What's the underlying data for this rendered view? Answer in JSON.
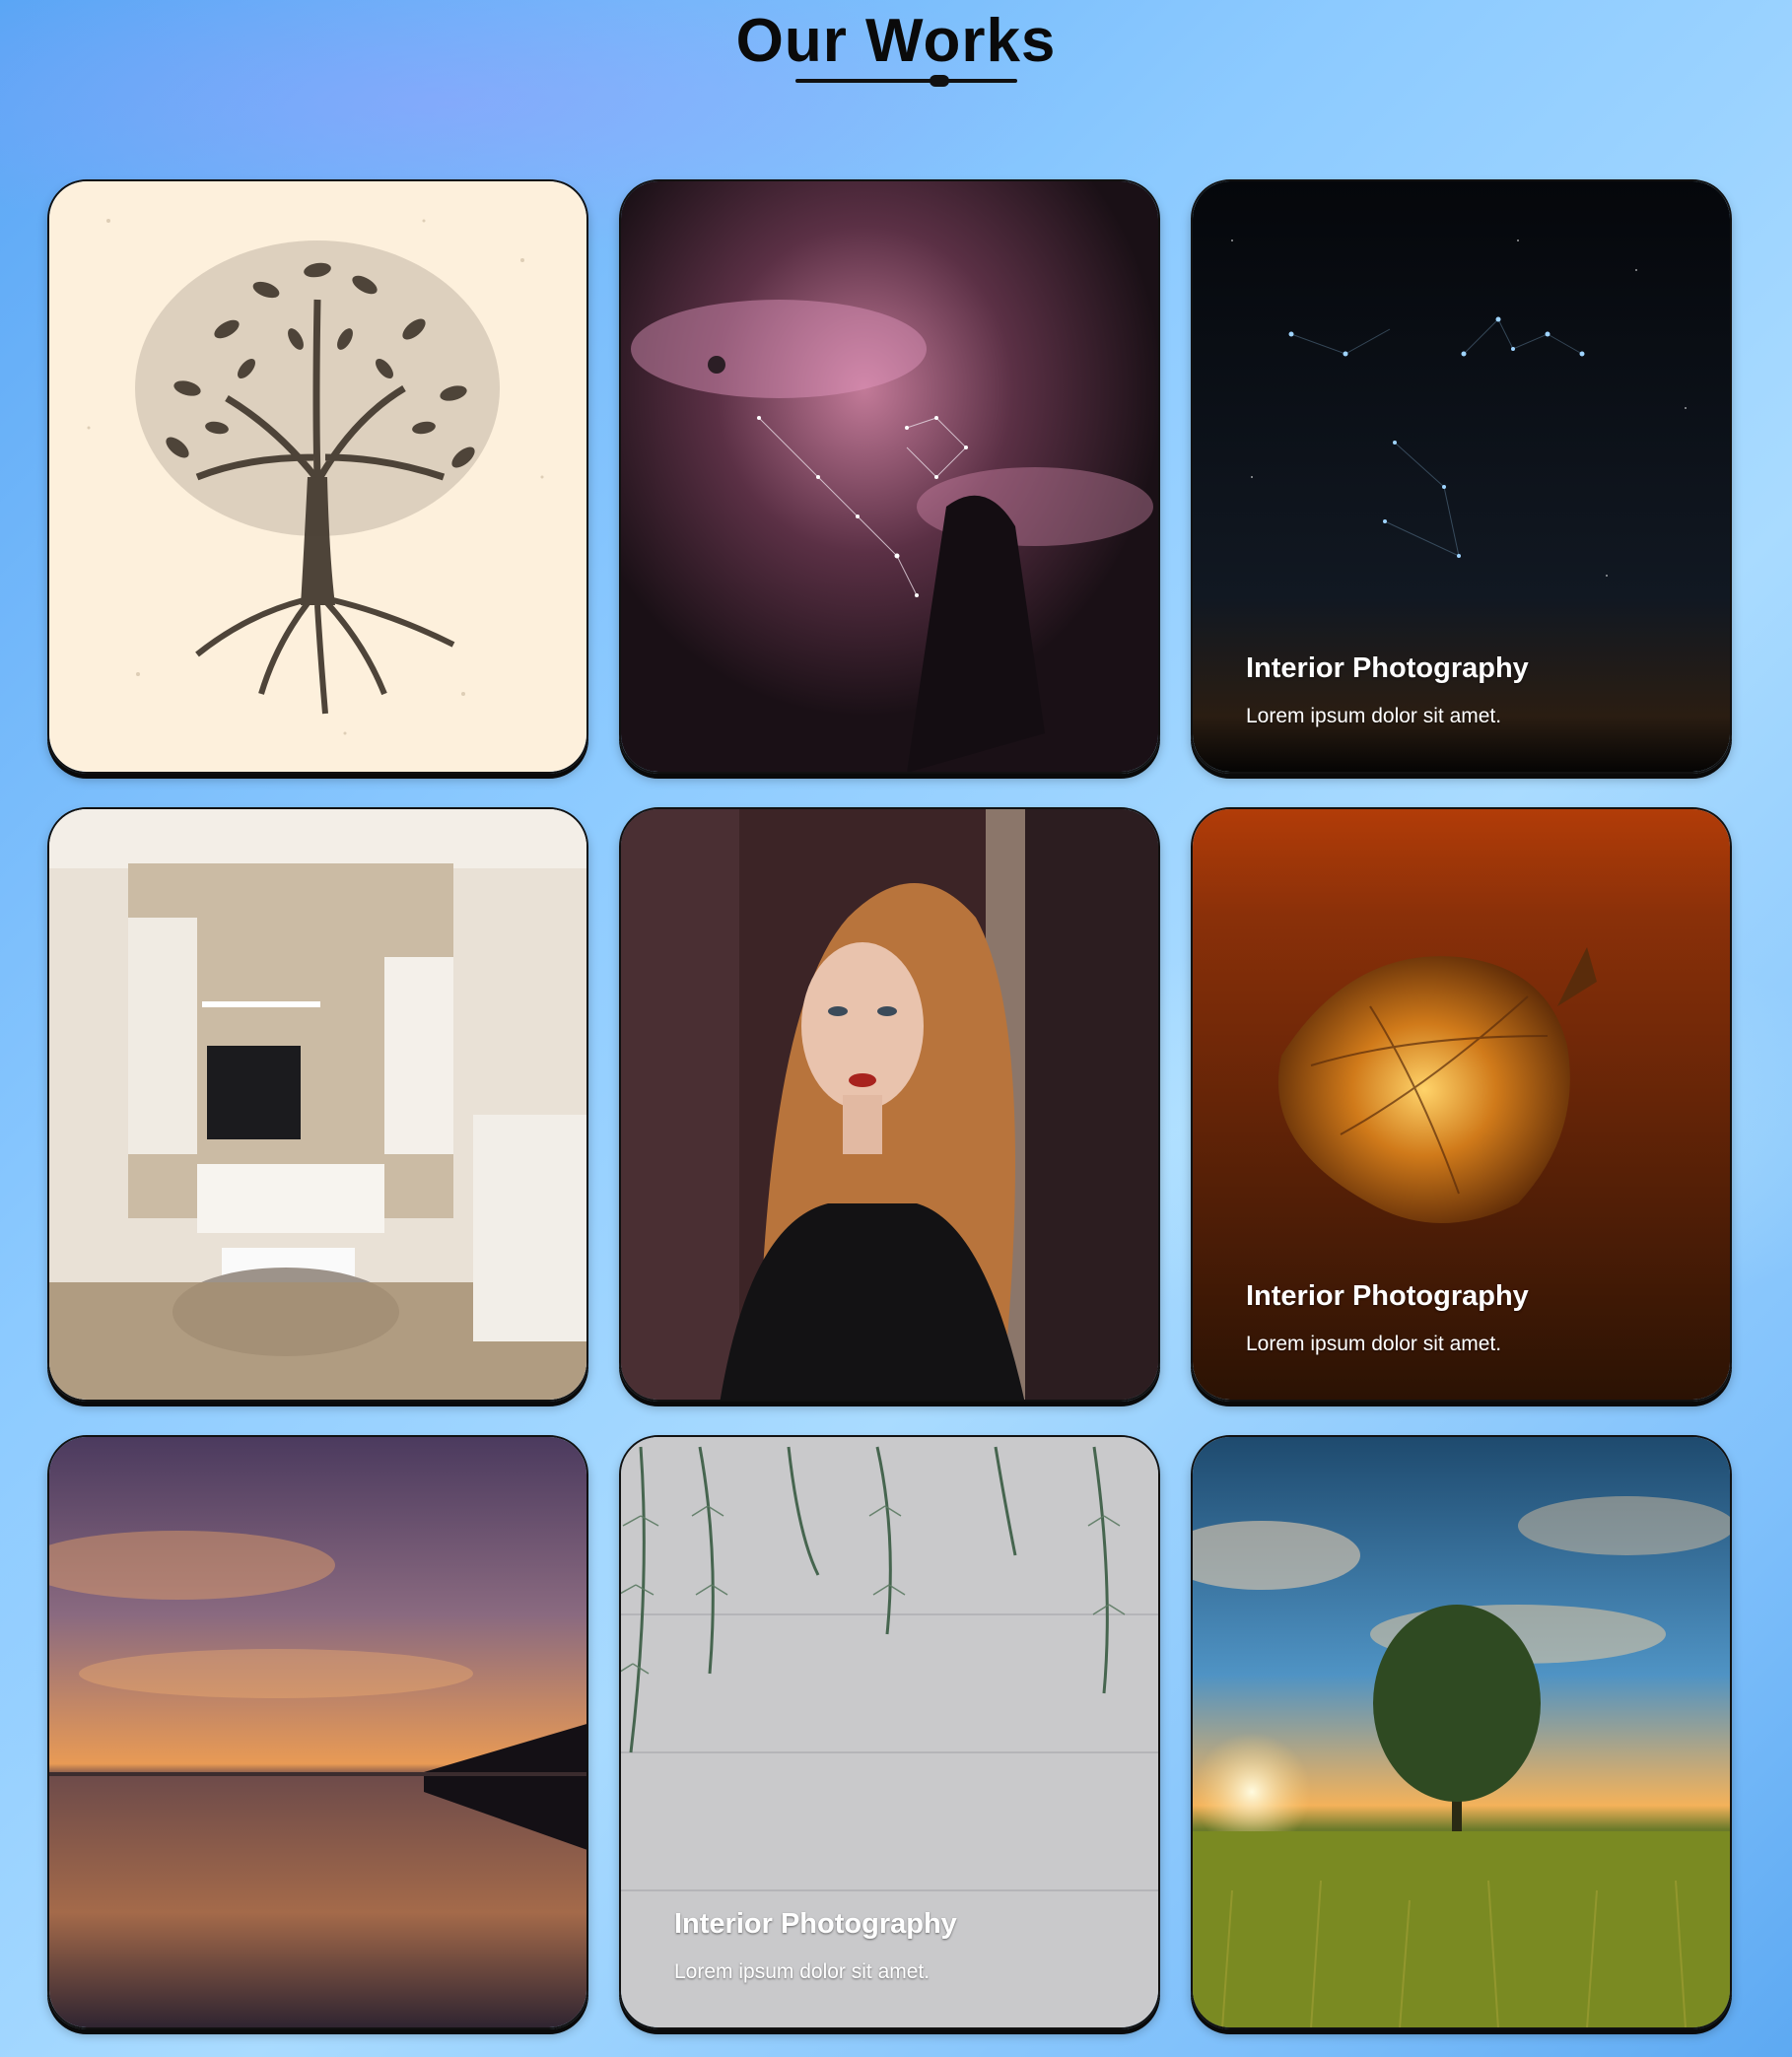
{
  "header": {
    "title": "Our Works"
  },
  "gallery": {
    "items": [
      {
        "image": "tree-of-life-illustration"
      },
      {
        "image": "nebula-constellation"
      },
      {
        "image": "night-sky-constellation",
        "title": "Interior Photography",
        "text": "Lorem ipsum dolor sit amet."
      },
      {
        "image": "living-room-interior"
      },
      {
        "image": "red-haired-woman-portrait"
      },
      {
        "image": "glowing-physalis-husk",
        "title": "Interior Photography",
        "text": "Lorem ipsum dolor sit amet."
      },
      {
        "image": "lake-sunset"
      },
      {
        "image": "pine-branches-on-wood",
        "title": "Interior Photography",
        "text": "Lorem ipsum dolor sit amet."
      },
      {
        "image": "lone-tree-sunset-field"
      }
    ]
  },
  "colors": {
    "title": "#0a0a0a",
    "background": "#8ccaff",
    "card_border": "#111111",
    "overlay_text": "#ffffff"
  }
}
